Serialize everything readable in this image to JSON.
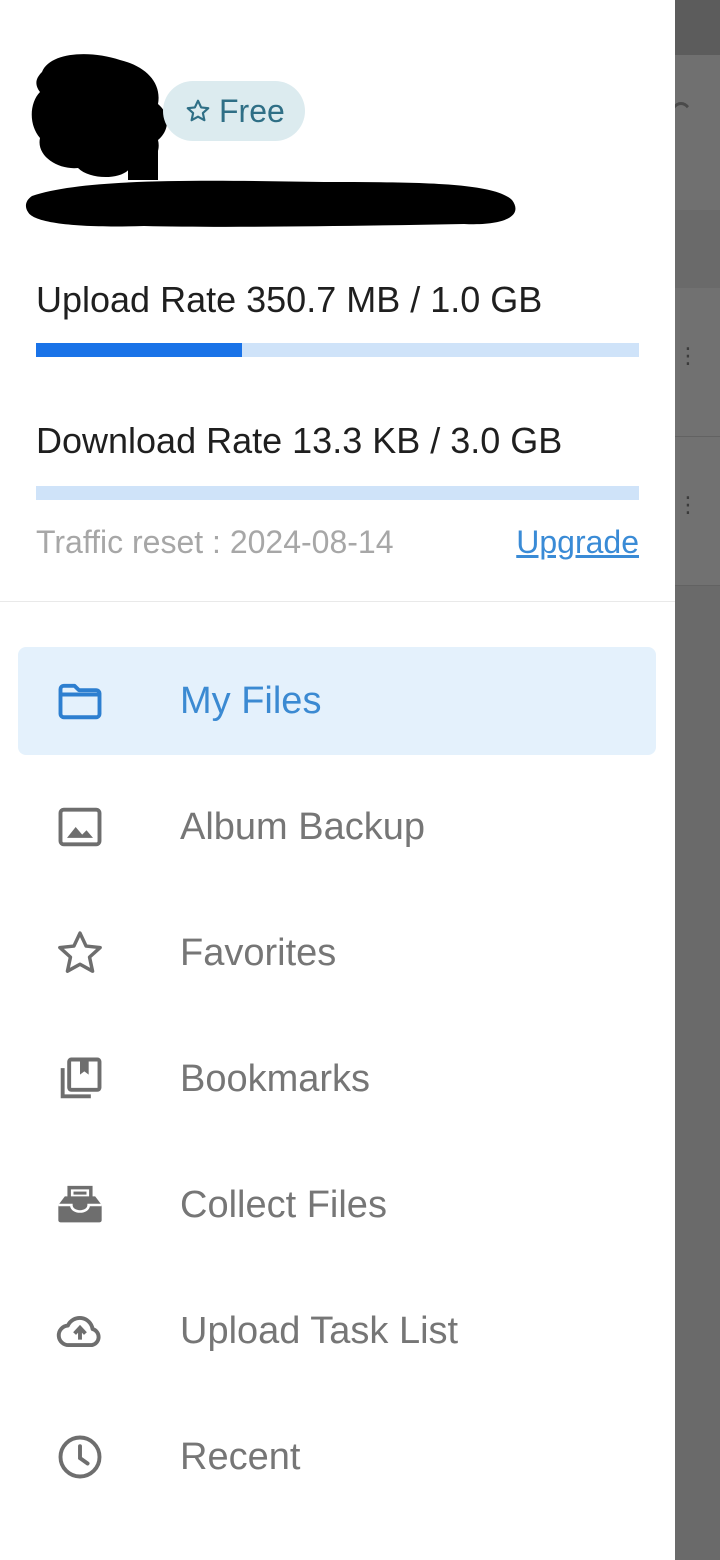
{
  "profile": {
    "plan_label": "Free"
  },
  "usage": {
    "upload": {
      "label": "Upload Rate 350.7 MB / 1.0 GB",
      "fraction": 0.342
    },
    "download": {
      "label": "Download Rate 13.3 KB / 3.0 GB",
      "fraction": 0.0
    },
    "reset_text": "Traffic reset : 2024-08-14",
    "upgrade_label": "Upgrade"
  },
  "menu": {
    "items": [
      {
        "label": "My Files",
        "icon": "folder-icon",
        "active": true
      },
      {
        "label": "Album Backup",
        "icon": "image-icon",
        "active": false
      },
      {
        "label": "Favorites",
        "icon": "star-icon",
        "active": false
      },
      {
        "label": "Bookmarks",
        "icon": "bookmarks-icon",
        "active": false
      },
      {
        "label": "Collect Files",
        "icon": "inbox-icon",
        "active": false
      },
      {
        "label": "Upload Task List",
        "icon": "cloud-upload-icon",
        "active": false
      },
      {
        "label": "Recent",
        "icon": "clock-icon",
        "active": false
      }
    ]
  },
  "colors": {
    "accent": "#1a73e8",
    "active_bg": "#e4f1fc",
    "badge_bg": "#dcebef"
  }
}
